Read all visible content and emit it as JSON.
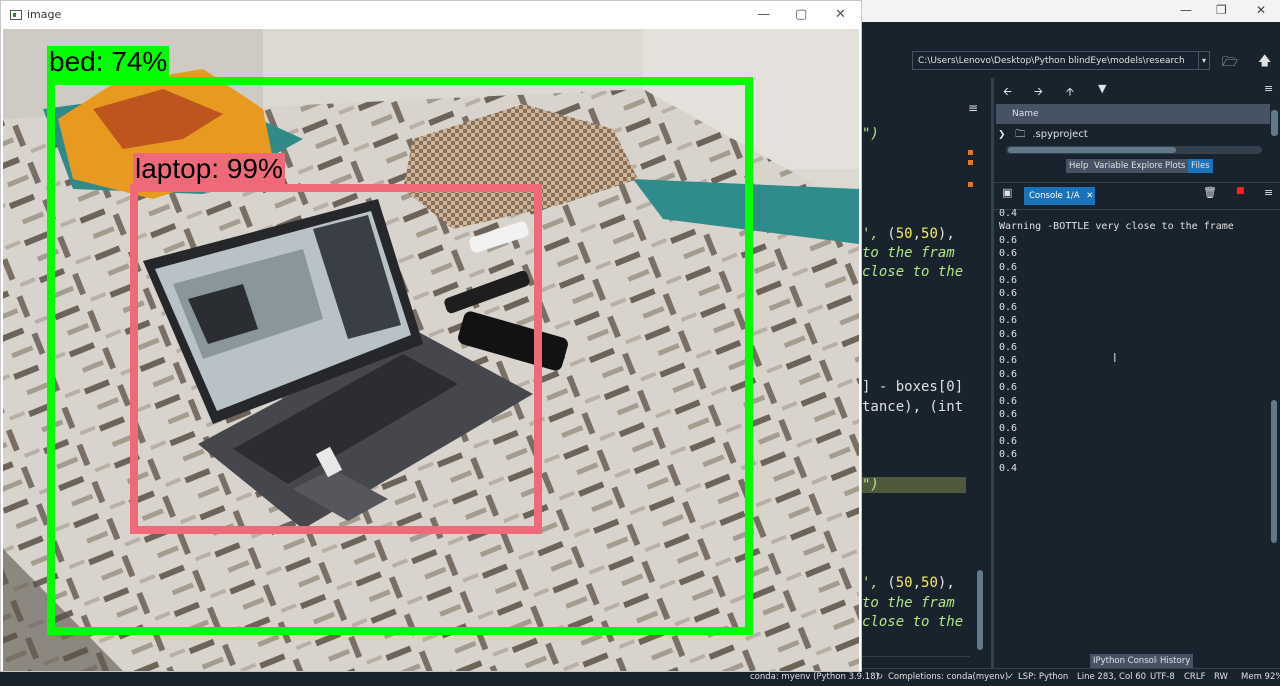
{
  "spyder": {
    "path": "C:\\Users\\Lenovo\\Desktop\\Python blindEye\\models\\research",
    "files": {
      "column_name": "Name",
      "rows": [
        ".spyproject"
      ]
    },
    "pane_tabs": [
      "Help",
      "Variable Explorer",
      "Plots",
      "Files"
    ],
    "active_pane_tab": "Files",
    "console": {
      "tab_label": "Console 1/A",
      "lines": [
        "0.4",
        "Warning -BOTTLE very close to the frame",
        "0.6",
        "0.6",
        "0.6",
        "0.6",
        "0.6",
        "0.6",
        "0.6",
        "0.6",
        "0.6",
        "0.6",
        "0.6",
        "0.6",
        "0.6",
        "0.6",
        "0.6",
        "0.6",
        "0.6",
        "0.4"
      ]
    },
    "bottom_tabs": [
      "IPython Console",
      "History"
    ],
    "editor_fragments": {
      "l1": "\")",
      "l2a": "', ",
      "l2b": "(",
      "l2c": "50",
      "l2d": ",",
      "l2e": "50",
      "l2f": "),",
      "l3": "to the fram",
      "l4": "close to the",
      "l5": "] - boxes[0]",
      "l6": "tance), (int",
      "l7": "\")",
      "l8a": "', ",
      "l8b": "(",
      "l8c": "50",
      "l8d": ",",
      "l8e": "50",
      "l8f": "),",
      "l9": "to the fram",
      "l10": "close to the"
    },
    "status": {
      "env": "conda: myenv (Python 3.9.18)",
      "completions": "Completions: conda(myenv)",
      "lsp": "LSP: Python",
      "position": "Line 283, Col 60",
      "encoding": "UTF-8",
      "eol": "CRLF",
      "mode": "RW",
      "mem": "Mem 92%"
    }
  },
  "cv_window": {
    "title": "image",
    "detections": [
      {
        "label": "bed: 74%",
        "color": "#00ff00"
      },
      {
        "label": "laptop: 99%",
        "color": "#ee6a78"
      }
    ]
  }
}
